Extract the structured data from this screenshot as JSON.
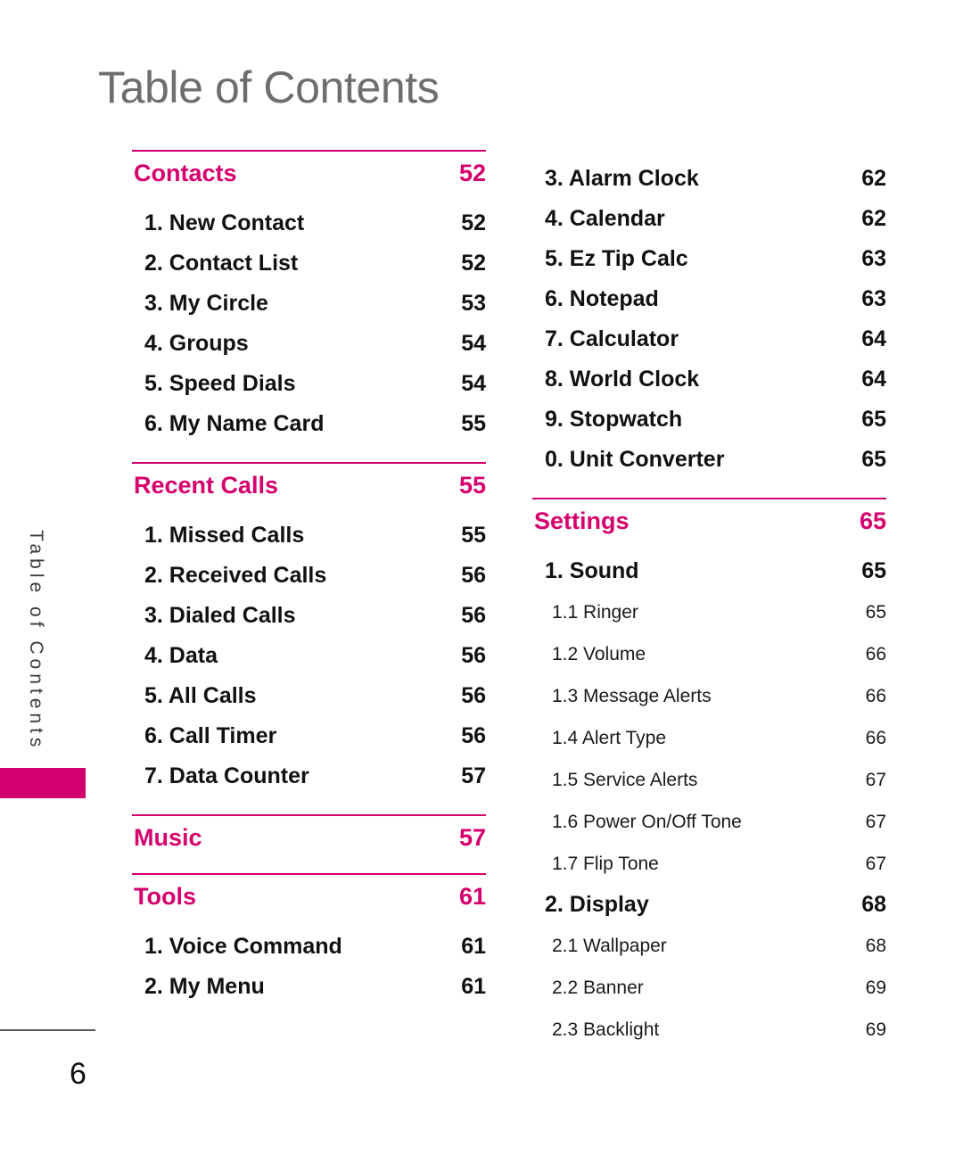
{
  "page": {
    "title": "Table of Contents",
    "side_tab_label": "Table of Contents",
    "page_number": "6",
    "accent_color": "#d6006d",
    "rule_color": "#e4549d",
    "title_color": "#6e6e6e"
  },
  "left_column": {
    "blocks": [
      {
        "kind": "section",
        "rule_above": true,
        "label": "Contacts",
        "pageno": "52",
        "items": [
          {
            "level": 1,
            "label": "1. New Contact",
            "pageno": "52"
          },
          {
            "level": 1,
            "label": "2. Contact List",
            "pageno": "52"
          },
          {
            "level": 1,
            "label": "3. My Circle",
            "pageno": "53"
          },
          {
            "level": 1,
            "label": "4. Groups",
            "pageno": "54"
          },
          {
            "level": 1,
            "label": "5. Speed Dials",
            "pageno": "54"
          },
          {
            "level": 1,
            "label": "6. My Name Card",
            "pageno": "55"
          }
        ]
      },
      {
        "kind": "section",
        "rule_above": true,
        "label": "Recent Calls",
        "pageno": "55",
        "items": [
          {
            "level": 1,
            "label": "1. Missed Calls",
            "pageno": "55"
          },
          {
            "level": 1,
            "label": "2. Received Calls",
            "pageno": "56"
          },
          {
            "level": 1,
            "label": "3. Dialed Calls",
            "pageno": "56"
          },
          {
            "level": 1,
            "label": "4. Data",
            "pageno": "56"
          },
          {
            "level": 1,
            "label": "5. All Calls",
            "pageno": "56"
          },
          {
            "level": 1,
            "label": "6. Call Timer",
            "pageno": "56"
          },
          {
            "level": 1,
            "label": "7. Data Counter",
            "pageno": "57"
          }
        ]
      },
      {
        "kind": "section",
        "rule_above": true,
        "label": "Music",
        "pageno": "57",
        "items": []
      },
      {
        "kind": "section",
        "rule_above": true,
        "label": "Tools",
        "pageno": "61",
        "items": [
          {
            "level": 1,
            "label": "1. Voice Command",
            "pageno": "61"
          },
          {
            "level": 1,
            "label": "2. My Menu",
            "pageno": "61"
          }
        ]
      }
    ]
  },
  "right_column": {
    "blocks": [
      {
        "kind": "continuation",
        "rule_above": false,
        "label": "",
        "pageno": "",
        "items": [
          {
            "level": 1,
            "label": "3. Alarm Clock",
            "pageno": "62"
          },
          {
            "level": 1,
            "label": "4. Calendar",
            "pageno": "62"
          },
          {
            "level": 1,
            "label": "5. Ez Tip Calc",
            "pageno": "63"
          },
          {
            "level": 1,
            "label": "6. Notepad",
            "pageno": "63"
          },
          {
            "level": 1,
            "label": "7. Calculator",
            "pageno": "64"
          },
          {
            "level": 1,
            "label": "8. World Clock",
            "pageno": "64"
          },
          {
            "level": 1,
            "label": "9. Stopwatch",
            "pageno": "65"
          },
          {
            "level": 1,
            "label": "0. Unit Converter",
            "pageno": "65"
          }
        ]
      },
      {
        "kind": "section",
        "rule_above": true,
        "label": "Settings",
        "pageno": "65",
        "items": [
          {
            "level": 1,
            "label": "1. Sound",
            "pageno": "65"
          },
          {
            "level": 2,
            "label": "1.1 Ringer",
            "pageno": "65"
          },
          {
            "level": 2,
            "label": "1.2 Volume",
            "pageno": "66"
          },
          {
            "level": 2,
            "label": "1.3 Message Alerts",
            "pageno": "66"
          },
          {
            "level": 2,
            "label": "1.4 Alert Type",
            "pageno": "66"
          },
          {
            "level": 2,
            "label": "1.5 Service Alerts",
            "pageno": "67"
          },
          {
            "level": 2,
            "label": "1.6 Power On/Off Tone",
            "pageno": "67"
          },
          {
            "level": 2,
            "label": "1.7 Flip Tone",
            "pageno": "67"
          },
          {
            "level": 1,
            "label": "2. Display",
            "pageno": "68"
          },
          {
            "level": 2,
            "label": "2.1 Wallpaper",
            "pageno": "68"
          },
          {
            "level": 2,
            "label": "2.2 Banner",
            "pageno": "69"
          },
          {
            "level": 2,
            "label": "2.3 Backlight",
            "pageno": "69"
          }
        ]
      }
    ]
  }
}
